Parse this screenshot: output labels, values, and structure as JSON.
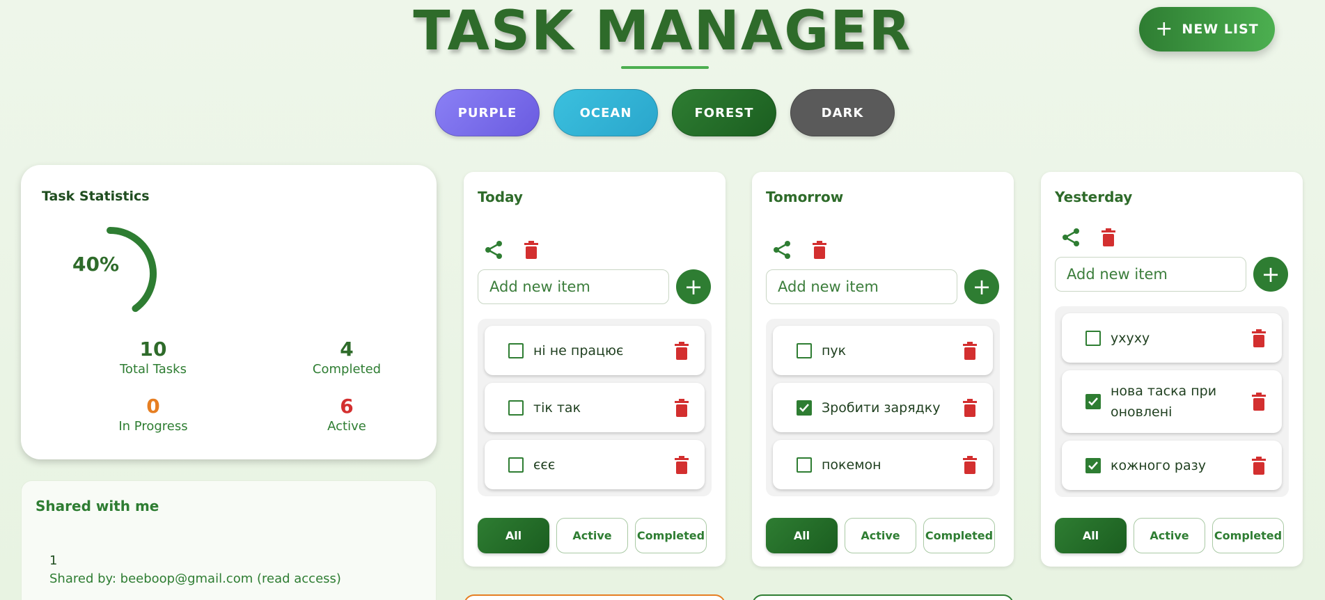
{
  "header": {
    "title": "TASK MANAGER",
    "new_list_label": "NEW LIST"
  },
  "themes": [
    {
      "label": "PURPLE"
    },
    {
      "label": "OCEAN"
    },
    {
      "label": "FOREST"
    },
    {
      "label": "DARK"
    }
  ],
  "stats": {
    "title": "Task Statistics",
    "percent_label": "40%",
    "percent": 0.4,
    "total_value": "10",
    "total_label": "Total Tasks",
    "completed_value": "4",
    "completed_label": "Completed",
    "in_progress_value": "0",
    "in_progress_label": "In Progress",
    "active_value": "6",
    "active_label": "Active"
  },
  "shared": {
    "title": "Shared with me",
    "item_name": "1",
    "shared_by": "Shared by: beeboop@gmail.com (read access)"
  },
  "lists": [
    {
      "title": "Today",
      "placeholder": "Add new item",
      "items": [
        {
          "text": "ні не працює",
          "checked": false
        },
        {
          "text": "тік так",
          "checked": false
        },
        {
          "text": "єєє",
          "checked": false
        }
      ]
    },
    {
      "title": "Tomorrow",
      "placeholder": "Add new item",
      "items": [
        {
          "text": "пук",
          "checked": false
        },
        {
          "text": "Зробити зарядку",
          "checked": true
        },
        {
          "text": "покемон",
          "checked": false
        }
      ]
    },
    {
      "title": "Yesterday",
      "placeholder": "Add new item",
      "items": [
        {
          "text": "ухуху",
          "checked": false
        },
        {
          "text": "нова таска при оновлені",
          "checked": true
        },
        {
          "text": "кожного разу",
          "checked": true
        }
      ]
    }
  ],
  "filters": {
    "all": "All",
    "active": "Active",
    "completed": "Completed",
    "selected": "All"
  },
  "colors": {
    "primary": "#2e7d32",
    "danger": "#d32f2f",
    "warning": "#e67e22"
  }
}
